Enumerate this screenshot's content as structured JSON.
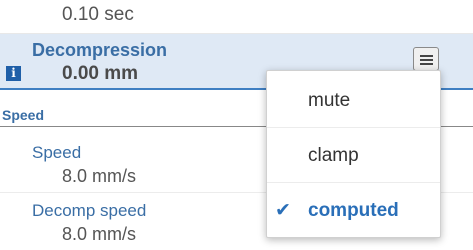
{
  "previous_row": {
    "value": "0.10 sec"
  },
  "decompression": {
    "label": "Decompression",
    "value": "0.00 mm",
    "info_icon": "info-icon",
    "menu_icon": "hamburger-icon"
  },
  "speed_section": {
    "title": "Speed",
    "rows": [
      {
        "label": "Speed",
        "value": "8.0 mm/s"
      },
      {
        "label": "Decomp speed",
        "value": "8.0 mm/s"
      }
    ]
  },
  "dropdown": {
    "options": [
      {
        "label": "mute",
        "selected": false
      },
      {
        "label": "clamp",
        "selected": false
      },
      {
        "label": "computed",
        "selected": true
      }
    ],
    "check_icon": "checkmark-icon"
  },
  "colors": {
    "accent": "#3a6ea5",
    "highlight_bg": "#dfe9f5",
    "selected": "#2a6fb8"
  }
}
